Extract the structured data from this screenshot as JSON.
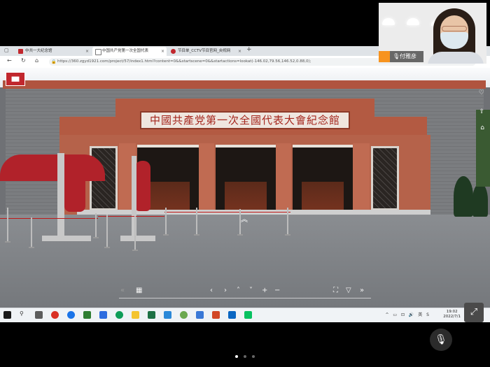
{
  "browser": {
    "tabs": [
      {
        "label": "中共一大纪念馆",
        "icon_color": "#c1272d"
      },
      {
        "label": "中国共产党第一次全国代表",
        "icon_color": "#555555"
      },
      {
        "label": "节目单_CCTV节目官网_央视网",
        "icon_color": "#c1272d"
      }
    ],
    "new_tab": "+",
    "url": "https://360.zgyd1921.com/project/57/index1.html?content=0&&startscene=0&&startactions=lookat(-146.02,79.56,146.52,0.88,0);"
  },
  "panorama": {
    "sign_text": "中國共產党第一次全國代表大會紀念館",
    "side_icons": [
      "heart-icon",
      "share-icon",
      "home-icon"
    ],
    "controls": [
      "«",
      "▦",
      "‹",
      "›",
      "˄",
      "˅",
      "+",
      "−",
      "⛶",
      "▽",
      "»"
    ]
  },
  "taskbar": {
    "time": "19:02",
    "date": "2022/7/1"
  },
  "video_call": {
    "participant_name": "付雅彦"
  },
  "colors": {
    "brick_red": "#b35a42",
    "sign_text": "#a5271e",
    "tent_red": "#b1222a"
  }
}
